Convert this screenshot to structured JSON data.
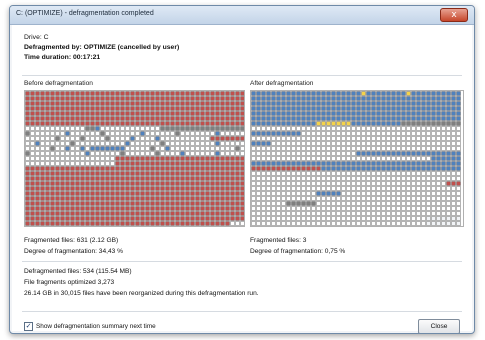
{
  "window": {
    "title": "C: (OPTIMIZE) - defragmentation completed",
    "close_glyph": "x"
  },
  "info": {
    "drive": "Drive: C",
    "defragmented_by": "Defragmented by: OPTIMIZE (cancelled by user)",
    "time_duration": "Time duration: 00:17:21"
  },
  "before": {
    "heading": "Before defragmentation",
    "fragmented_files": "Fragmented files: 631 (2.12 GB)",
    "degree": "Degree of fragmentation: 34,43 %"
  },
  "after": {
    "heading": "After defragmentation",
    "fragmented_files": "Fragmented files: 3",
    "degree": "Degree of fragmentation: 0,75 %"
  },
  "summary": {
    "defragmented_files": "Defragmented files: 534 (115.54 MB)",
    "fragments_optimized": "File fragments optimized 3,273",
    "reorganized": "26.14 GB in 30,015 files have been reorganized during this defragmentation run."
  },
  "footer": {
    "checkbox_label": "Show defragmentation summary next time",
    "checkbox_checked": true,
    "close_button": "Close"
  },
  "colors": {
    "fragmented": "#c0504d",
    "contiguous": "#4f81bd",
    "free": "#ffffff",
    "unmovable": "#7f7f7f",
    "system": "#f5d34a",
    "grid_line": "#6b6b6b"
  }
}
